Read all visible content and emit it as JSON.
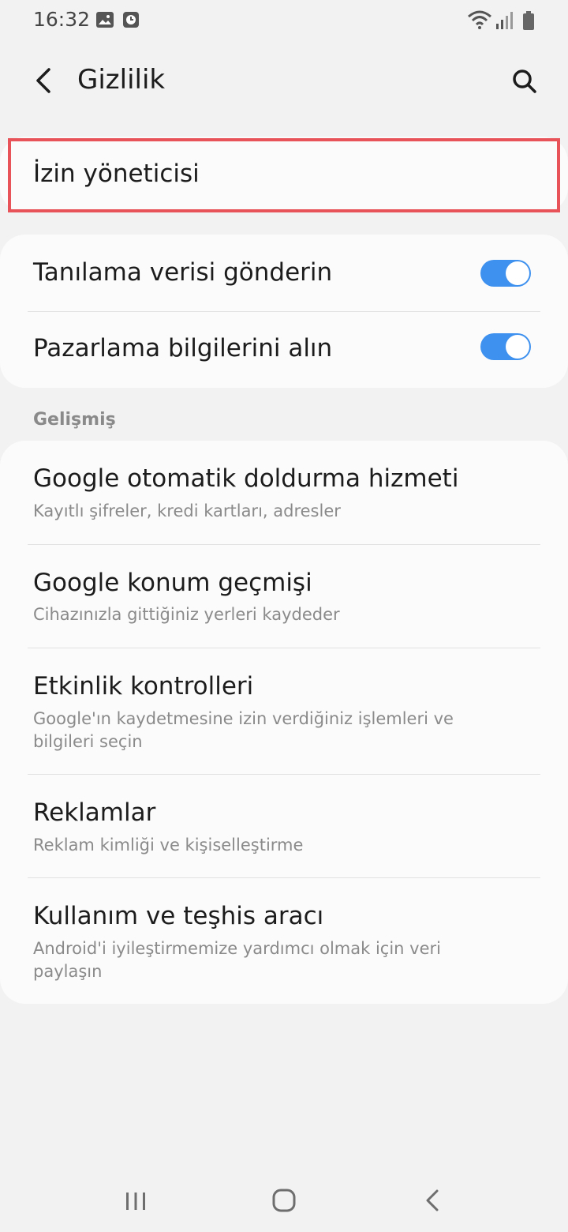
{
  "status_bar": {
    "time": "16:32",
    "icons": [
      "image-icon",
      "clock-icon",
      "wifi-icon",
      "signal-icon",
      "battery-icon"
    ]
  },
  "header": {
    "title": "Gizlilik",
    "back_icon": "back-arrow-icon",
    "search_icon": "search-icon"
  },
  "permission_manager": {
    "label": "İzin yöneticisi"
  },
  "toggles": [
    {
      "label": "Tanılama verisi gönderin",
      "enabled": true
    },
    {
      "label": "Pazarlama bilgilerini alın",
      "enabled": true
    }
  ],
  "advanced": {
    "section_label": "Gelişmiş",
    "items": [
      {
        "title": "Google otomatik doldurma hizmeti",
        "subtitle": "Kayıtlı şifreler, kredi kartları, adresler"
      },
      {
        "title": "Google konum geçmişi",
        "subtitle": "Cihazınızla gittiğiniz yerleri kaydeder"
      },
      {
        "title": "Etkinlik kontrolleri",
        "subtitle": "Google'ın kaydetmesine izin verdiğiniz işlemleri ve bilgileri seçin"
      },
      {
        "title": "Reklamlar",
        "subtitle": "Reklam kimliği ve kişiselleştirme"
      },
      {
        "title": "Kullanım ve teşhis aracı",
        "subtitle": "Android'i iyileştirmemize yardımcı olmak için veri paylaşın"
      }
    ]
  },
  "nav_bar": {
    "icons": [
      "recents-icon",
      "home-icon",
      "back-icon"
    ]
  },
  "colors": {
    "accent": "#3e91ee",
    "highlight": "#e8535a",
    "background": "#f2f2f2",
    "card": "#fbfbfb"
  }
}
